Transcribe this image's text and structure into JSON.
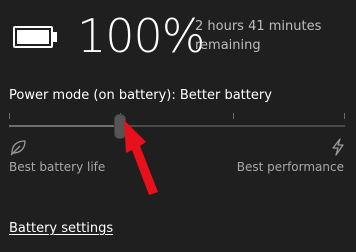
{
  "battery": {
    "percent": "100%",
    "remaining_line1": "2 hours 41 minutes",
    "remaining_line2": "remaining",
    "icon": "battery-full-icon"
  },
  "power_mode": {
    "label": "Power mode (on battery): Better battery",
    "slider_value": 0.33,
    "tick_positions": [
      0.0,
      0.33,
      0.67,
      1.0
    ],
    "left_label": "Best battery life",
    "right_label": "Best performance",
    "left_icon": "leaf-icon",
    "right_icon": "lightning-bolt-icon"
  },
  "links": {
    "battery_settings": "Battery settings"
  },
  "annotation": {
    "icon": "red-arrow-icon",
    "color": "#e8101a"
  },
  "colors": {
    "background": "#1f1f1f",
    "text": "#ffffff",
    "secondary_text": "#bdbdbd"
  }
}
